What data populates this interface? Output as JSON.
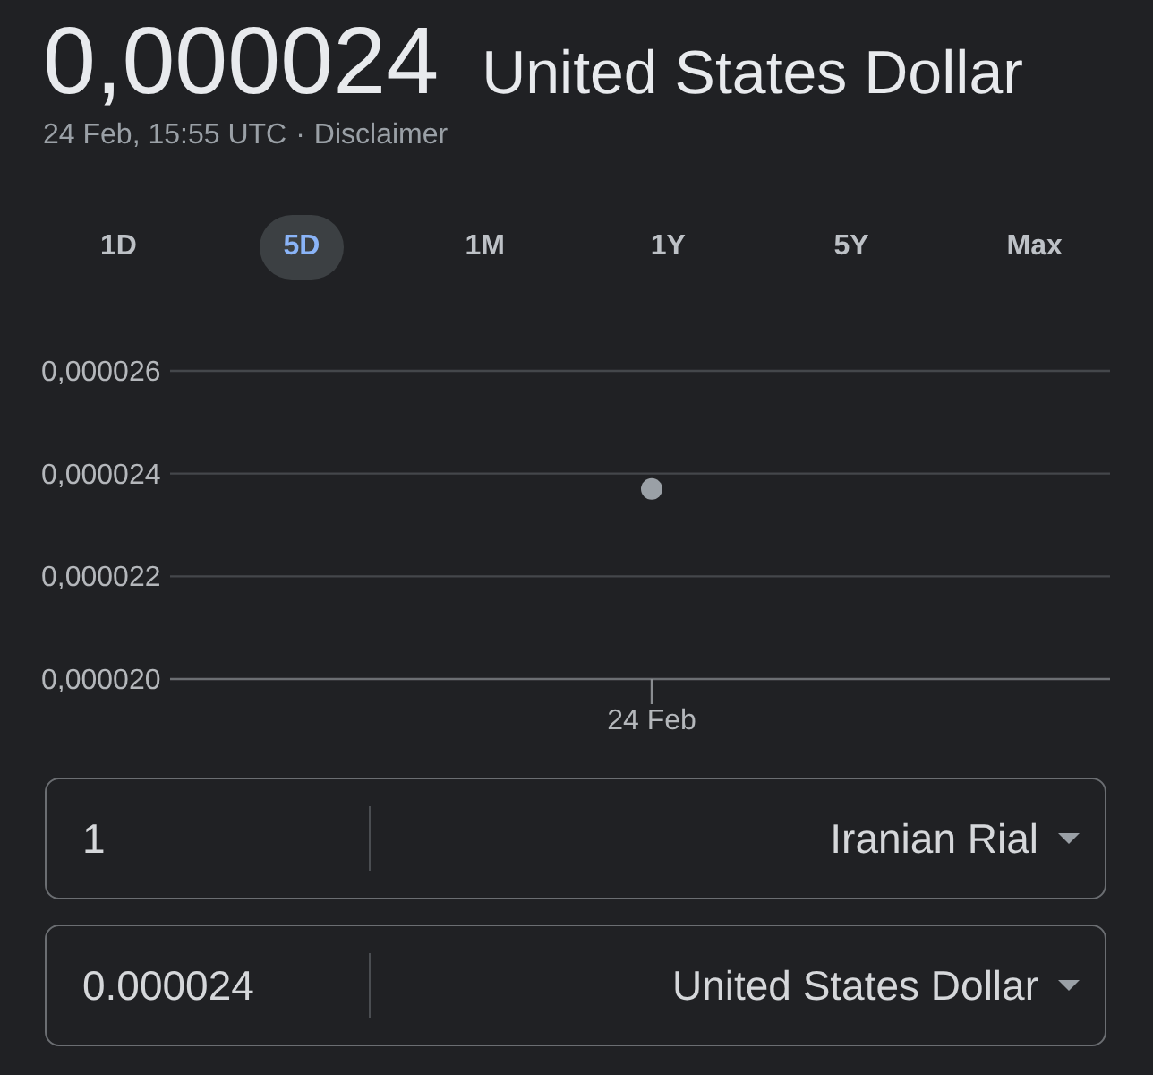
{
  "rate": {
    "value": "0,000024",
    "currency": "United States Dollar"
  },
  "updated": {
    "timestamp": "24 Feb, 15:55 UTC",
    "separator": "·",
    "disclaimer": "Disclaimer"
  },
  "ranges": [
    {
      "label": "1D",
      "selected": false
    },
    {
      "label": "5D",
      "selected": true
    },
    {
      "label": "1M",
      "selected": false
    },
    {
      "label": "1Y",
      "selected": false
    },
    {
      "label": "5Y",
      "selected": false
    },
    {
      "label": "Max",
      "selected": false
    }
  ],
  "chart": {
    "chart_data": {
      "type": "line",
      "categories": [
        "24 Feb"
      ],
      "series": [
        {
          "color": "#9aa0a6",
          "marker": true,
          "values": [
            2.37e-05
          ]
        }
      ],
      "ylim": [
        2e-05,
        2.6e-05
      ],
      "yticks": [
        {
          "value": 2.6e-05,
          "label": "0,000026"
        },
        {
          "value": 2.4e-05,
          "label": "0,000024"
        },
        {
          "value": 2.2e-05,
          "label": "0,000022"
        },
        {
          "value": 2e-05,
          "label": "0,000020"
        }
      ]
    }
  },
  "converter": [
    {
      "amount": "1",
      "currency": "Iranian Rial"
    },
    {
      "amount": "0.000024",
      "currency": "United States Dollar"
    }
  ]
}
